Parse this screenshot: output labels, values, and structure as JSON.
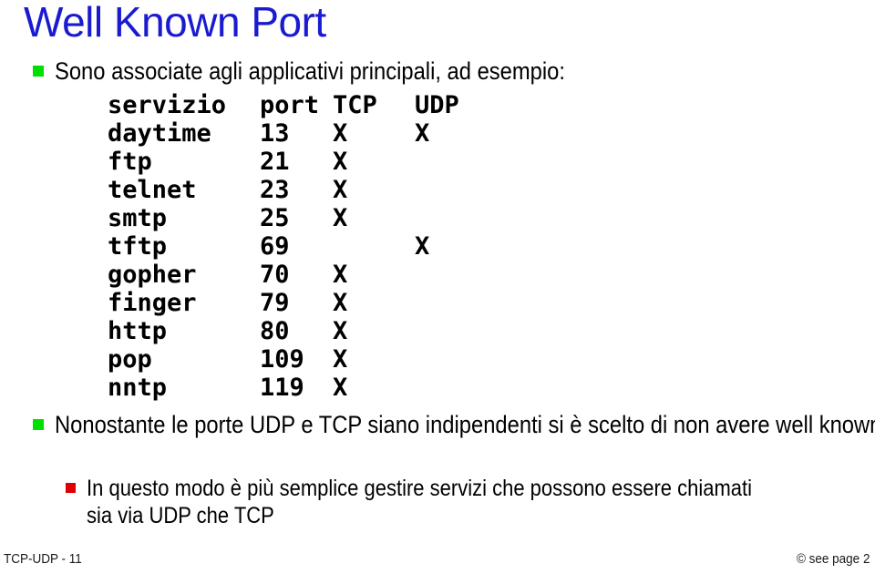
{
  "slide": {
    "title": "Well Known Port",
    "title_color": "#1a1ad0",
    "background_color": "#ffffff"
  },
  "bullets": {
    "level1_intro": {
      "marker": "green-square-bullet",
      "marker_color": "#00e000",
      "text": "Sono associate agli applicativi principali, ad esempio:"
    },
    "level1_note": {
      "marker": "green-square-bullet",
      "marker_color": "#00e000",
      "text": "Nonostante le porte UDP e TCP siano indipendenti si è scelto di non avere well known port sovrapposte"
    },
    "level2_note": {
      "marker": "red-square-bullet",
      "marker_color": "#e00000",
      "text": "In questo modo è più semplice gestire servizi che possono essere chiamati sia via UDP che TCP"
    }
  },
  "port_table": {
    "headers": [
      "servizio",
      "port",
      "TCP",
      "UDP"
    ],
    "rows": [
      {
        "servizio": "daytime",
        "port": "13",
        "tcp": "X",
        "udp": "X"
      },
      {
        "servizio": "ftp",
        "port": "21",
        "tcp": "X",
        "udp": ""
      },
      {
        "servizio": "telnet",
        "port": "23",
        "tcp": "X",
        "udp": ""
      },
      {
        "servizio": "smtp",
        "port": "25",
        "tcp": "X",
        "udp": ""
      },
      {
        "servizio": "tftp",
        "port": "69",
        "tcp": "",
        "udp": "X"
      },
      {
        "servizio": "gopher",
        "port": "70",
        "tcp": "X",
        "udp": ""
      },
      {
        "servizio": "finger",
        "port": "79",
        "tcp": "X",
        "udp": ""
      },
      {
        "servizio": "http",
        "port": "80",
        "tcp": "X",
        "udp": ""
      },
      {
        "servizio": "pop",
        "port": "109",
        "tcp": "X",
        "udp": ""
      },
      {
        "servizio": "nntp",
        "port": "119",
        "tcp": "X",
        "udp": ""
      }
    ]
  },
  "footer": {
    "left": "TCP-UDP - 11",
    "right": "© see page 2"
  }
}
